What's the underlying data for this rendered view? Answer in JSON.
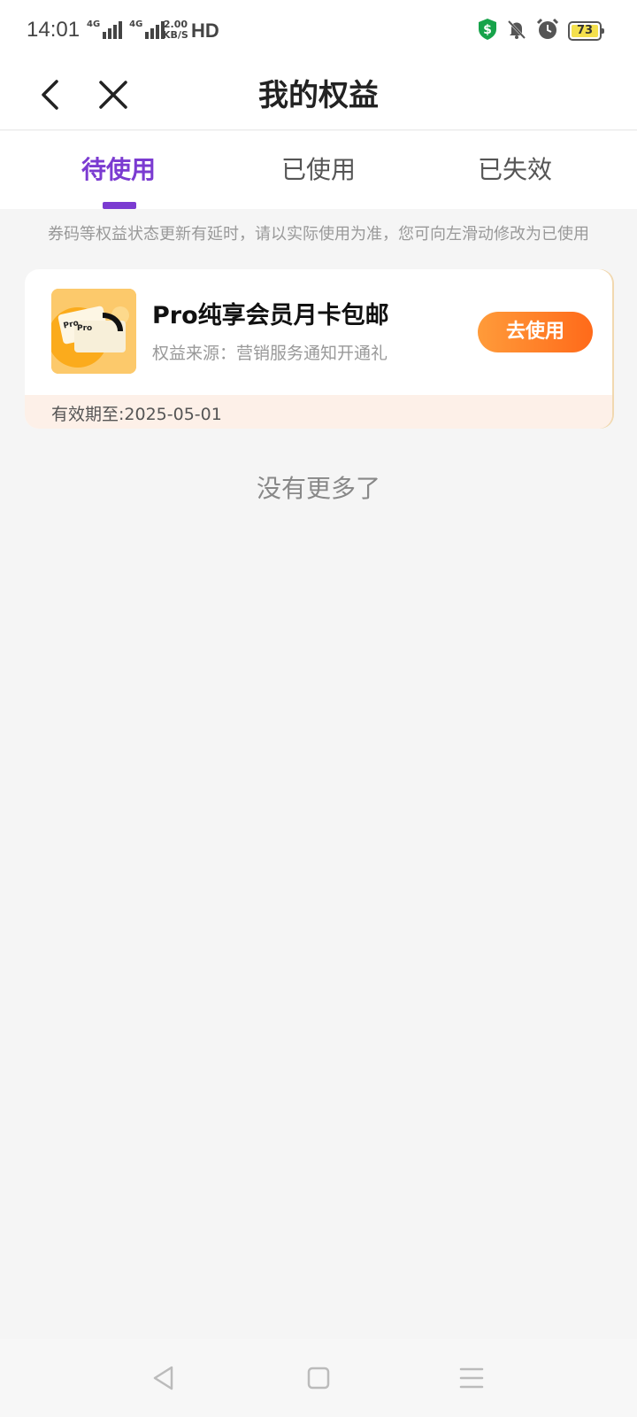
{
  "status_bar": {
    "time": "14:01",
    "signal1": "4G",
    "signal2": "4G",
    "speed_value": "2.00",
    "speed_unit": "KB/S",
    "hd": "HD",
    "battery": "73"
  },
  "header": {
    "title": "我的权益"
  },
  "tabs": [
    {
      "label": "待使用",
      "active": true
    },
    {
      "label": "已使用",
      "active": false
    },
    {
      "label": "已失效",
      "active": false
    }
  ],
  "notice": "券码等权益状态更新有延时，请以实际使用为准，您可向左滑动修改为已使用",
  "cards": [
    {
      "title": "Pro纯享会员月卡包邮",
      "source": "权益来源：营销服务通知开通礼",
      "button_label": "去使用",
      "validity": "有效期至:2025-05-01"
    }
  ],
  "no_more": "没有更多了",
  "colors": {
    "accent": "#7b3bd1",
    "button_start": "#ff9b3a",
    "button_end": "#ff6a1a",
    "footer_bg": "#fdf0e8"
  }
}
